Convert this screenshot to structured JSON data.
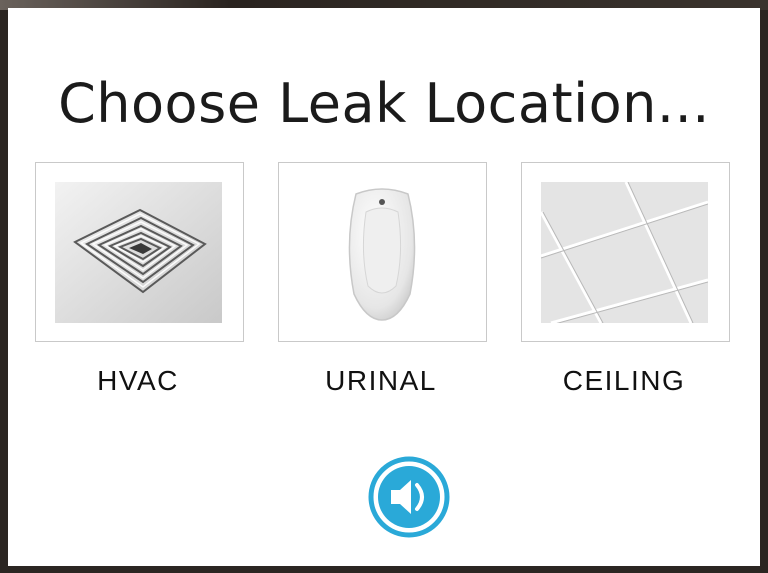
{
  "screen": {
    "title": "Choose Leak Location..."
  },
  "options": [
    {
      "label": "HVAC",
      "image": "hvac-vent-image"
    },
    {
      "label": "URINAL",
      "image": "urinal-image"
    },
    {
      "label": "CEILING",
      "image": "ceiling-tiles-image"
    }
  ],
  "audio": {
    "icon": "speaker-icon"
  },
  "colors": {
    "accent": "#2aa9d8",
    "frame": "#c9c9c9",
    "text": "#1b1b1b"
  }
}
